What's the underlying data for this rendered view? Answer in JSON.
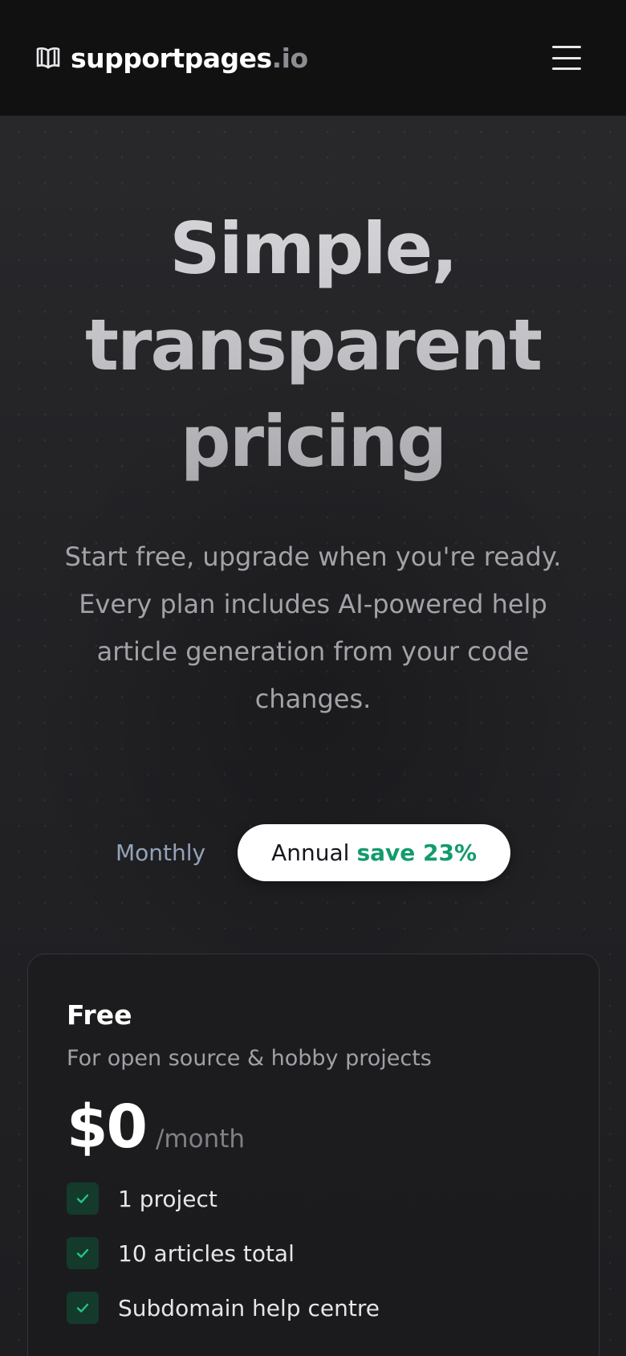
{
  "header": {
    "brand_name": "supportpages",
    "brand_tld": ".io",
    "logo_icon": "open-book-icon",
    "menu_icon": "hamburger-menu-icon"
  },
  "hero": {
    "title_line1": "Simple,",
    "title_line2": "transparent",
    "title_line3": "pricing",
    "subtitle": "Start free, upgrade when you're ready. Every plan includes AI-powered help article generation from your code changes."
  },
  "billing": {
    "monthly_label": "Monthly",
    "annual_label": "Annual",
    "annual_badge": "save 23%",
    "selected": "Annual"
  },
  "plans": [
    {
      "name": "Free",
      "description": "For open source & hobby projects",
      "price": "$0",
      "period": "/month",
      "features": [
        "1 project",
        "10 articles total",
        "Subdomain help centre"
      ]
    }
  ],
  "colors": {
    "header_bg": "#111112",
    "page_bg": "#232326",
    "accent_green": "#129b6c",
    "check_bg": "#143a2c",
    "monthly_text": "#93a3b8"
  }
}
